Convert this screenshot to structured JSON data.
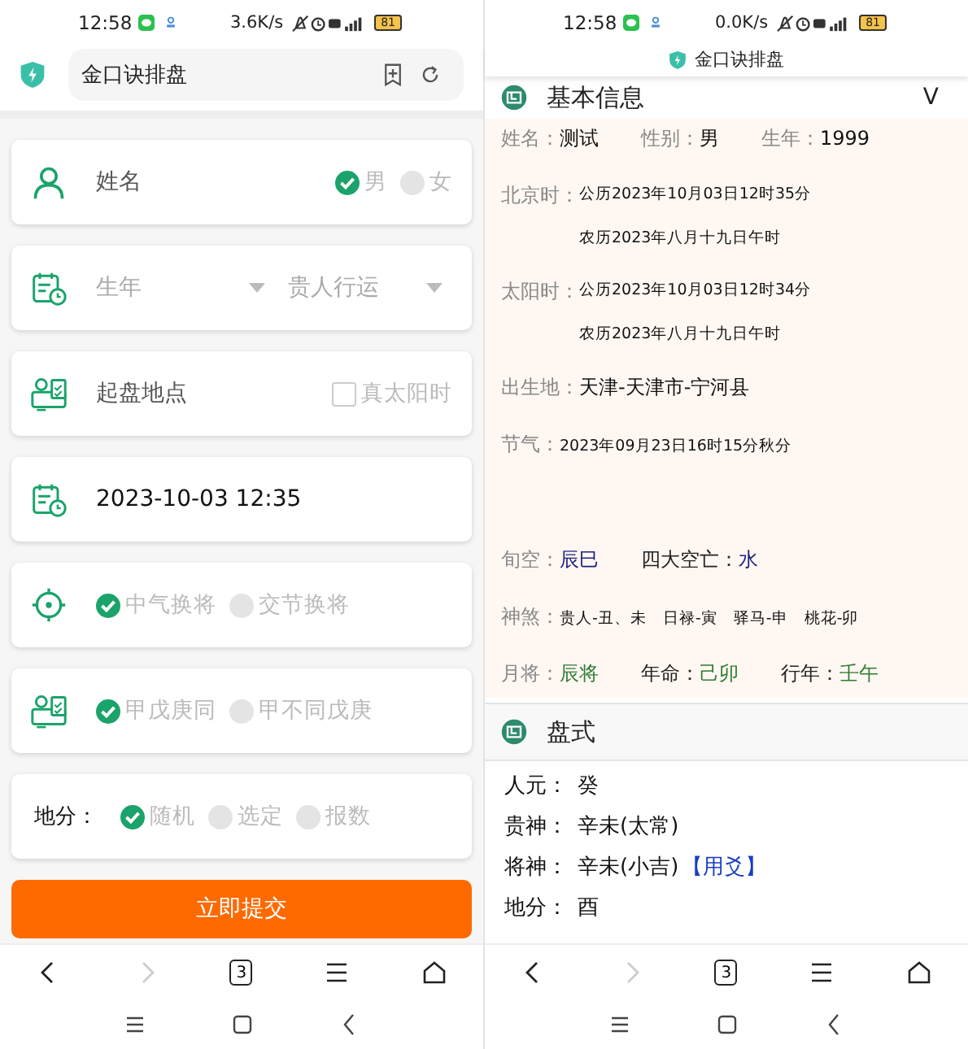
{
  "left": {
    "status": {
      "time": "12:58",
      "speed": "3.6K/s",
      "battery": "81"
    },
    "address_bar": {
      "title": "金口诀排盘"
    },
    "name_card": {
      "label": "姓名",
      "options": [
        {
          "label": "男",
          "selected": true
        },
        {
          "label": "女",
          "selected": false
        }
      ]
    },
    "year_card": {
      "year_placeholder": "生年",
      "mode": "贵人行运"
    },
    "place_card": {
      "label": "起盘地点",
      "checkbox": {
        "label": "真太阳时",
        "checked": false
      }
    },
    "datetime_card": {
      "value": "2023-10-03 12:35"
    },
    "option_cards": [
      {
        "kind": "target",
        "options": [
          {
            "label": "中气换将",
            "selected": true
          },
          {
            "label": "交节换将",
            "selected": false
          }
        ]
      },
      {
        "kind": "person-card",
        "options": [
          {
            "label": "甲戊庚同",
            "selected": true
          },
          {
            "label": "甲不同戊庚",
            "selected": false
          }
        ]
      }
    ],
    "difen_card": {
      "label": "地分：",
      "options": [
        {
          "label": "随机",
          "selected": true
        },
        {
          "label": "选定",
          "selected": false
        },
        {
          "label": "报数",
          "selected": false
        }
      ]
    },
    "submit": "立即提交",
    "tab_count": "3"
  },
  "right": {
    "status": {
      "time": "12:58",
      "speed": "0.0K/s",
      "battery": "81"
    },
    "page_title": "金口诀排盘",
    "basic": {
      "title": "基本信息",
      "toggle": "V",
      "rows": [
        {
          "kind": "fields",
          "fields": [
            {
              "label": "姓名：",
              "value": "测试"
            },
            {
              "label": "性别：",
              "value": "男"
            },
            {
              "label": "生年：",
              "value": "1999"
            }
          ]
        },
        {
          "kind": "dates",
          "label": "北京时：",
          "lines": [
            "公历2023年10月03日12时35分",
            "农历2023年八月十九日午时"
          ]
        },
        {
          "kind": "dates",
          "label": "太阳时：",
          "lines": [
            "公历2023年10月03日12时34分",
            "农历2023年八月十九日午时"
          ]
        },
        {
          "kind": "fields",
          "fields": [
            {
              "label": "出生地：",
              "value": "天津-天津市-宁河县"
            }
          ]
        },
        {
          "kind": "small",
          "label": "节气：",
          "values": [
            "2023年09月23日16时15分秋分"
          ]
        },
        {
          "kind": "fields",
          "fields": [
            {
              "label": "旬空：",
              "value": "辰巳",
              "color": "#1a237e"
            },
            {
              "label": "四大空亡：",
              "value": "水",
              "color": "#1a237e",
              "dark_label": true
            }
          ]
        },
        {
          "kind": "small",
          "label": "神煞：",
          "values": [
            "贵人-丑、未",
            "日禄-寅",
            "驿马-申",
            "桃花-卯"
          ]
        },
        {
          "kind": "fields",
          "fields": [
            {
              "label": "月将：",
              "value": "辰将",
              "color": "#2e7d32"
            },
            {
              "label": "年命：",
              "value": "己卯",
              "color": "#2e7d32",
              "dark_label": true
            },
            {
              "label": "行年：",
              "value": "壬午",
              "color": "#2e7d32",
              "dark_label": true
            }
          ]
        }
      ]
    },
    "pan": {
      "title": "盘式",
      "rows": [
        {
          "label": "人元：",
          "value": "癸"
        },
        {
          "label": "贵神：",
          "value": "辛未(太常)"
        },
        {
          "label": "将神：",
          "value": "辛未(小吉)",
          "link": "【用爻】"
        },
        {
          "label": "地分：",
          "value": "酉"
        }
      ]
    },
    "tab_count": "3"
  }
}
